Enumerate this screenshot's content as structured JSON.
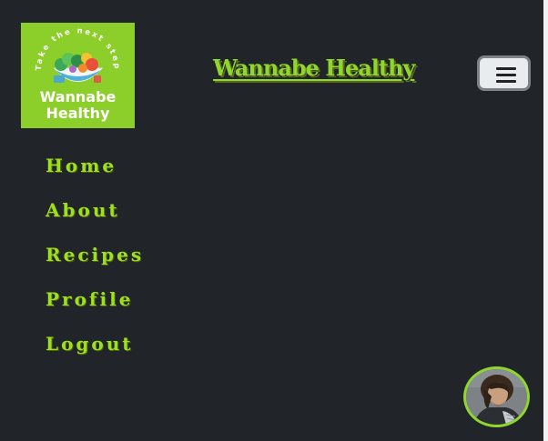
{
  "logo": {
    "arc_text": "Take the next step",
    "line1": "Wannabe",
    "line2": "Healthy",
    "background": "#8ccf2a"
  },
  "header": {
    "brand": "Wannabe Healthy",
    "menu_icon": "hamburger-icon"
  },
  "nav": {
    "items": [
      {
        "label": "Home"
      },
      {
        "label": "About"
      },
      {
        "label": "Recipes"
      },
      {
        "label": "Profile"
      },
      {
        "label": "Logout"
      }
    ]
  },
  "avatar": {
    "icon": "user-avatar"
  },
  "colors": {
    "background": "#212529",
    "accent": "#9ee01d"
  }
}
